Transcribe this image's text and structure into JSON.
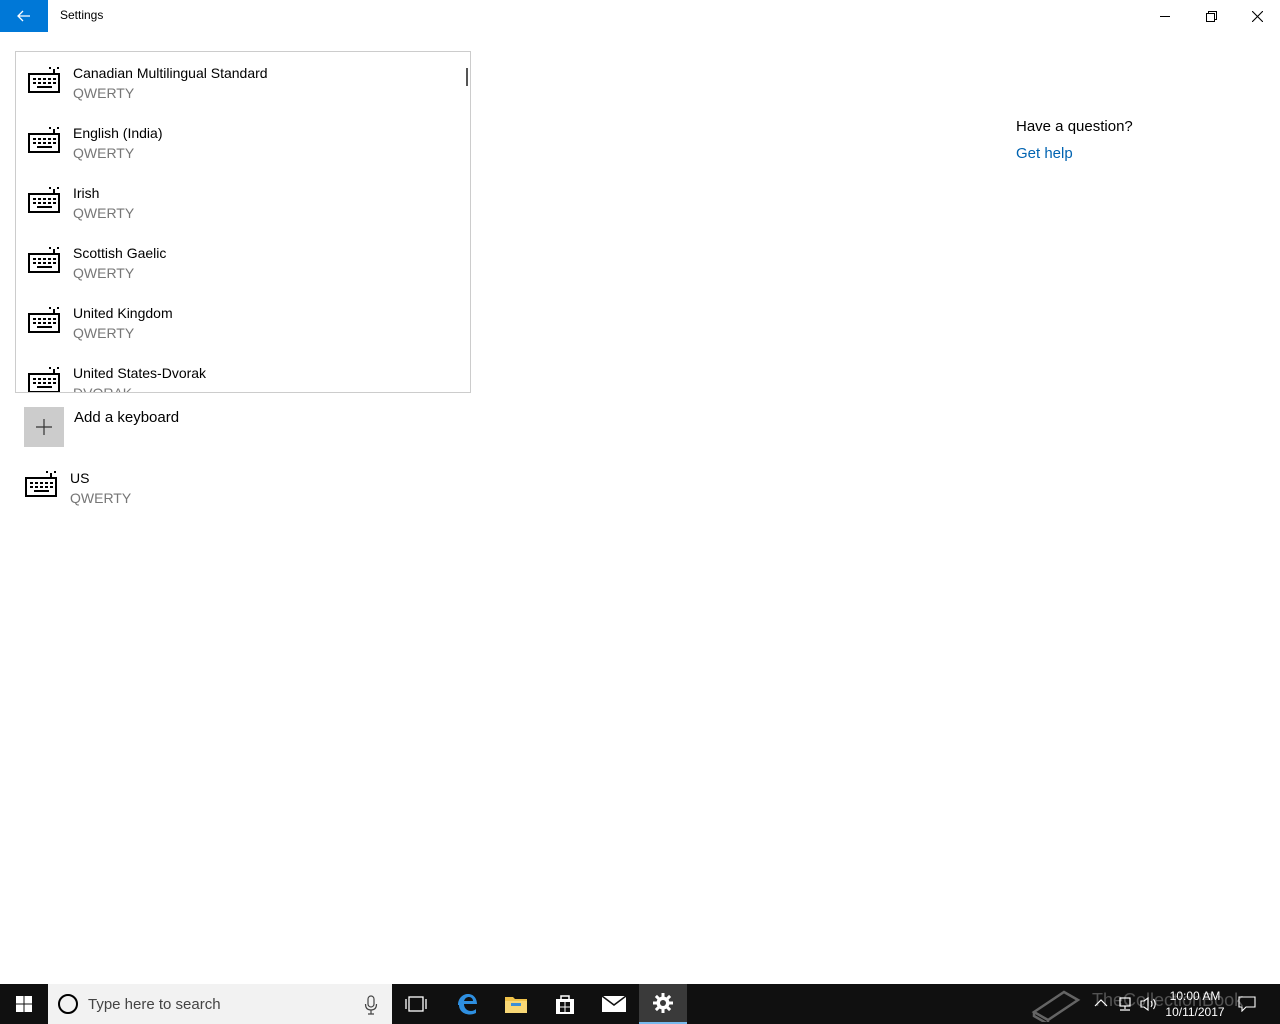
{
  "window": {
    "title": "Settings"
  },
  "keyboard_options": [
    {
      "name": "Canadian Multilingual Standard",
      "layout": "QWERTY"
    },
    {
      "name": "English (India)",
      "layout": "QWERTY"
    },
    {
      "name": "Irish",
      "layout": "QWERTY"
    },
    {
      "name": "Scottish Gaelic",
      "layout": "QWERTY"
    },
    {
      "name": "United Kingdom",
      "layout": "QWERTY"
    },
    {
      "name": "United States-Dvorak",
      "layout": "DVORAK"
    }
  ],
  "add_keyboard": {
    "label": "Add a keyboard"
  },
  "installed_keyboard": {
    "name": "US",
    "layout": "QWERTY"
  },
  "help": {
    "question": "Have a question?",
    "link": "Get help"
  },
  "taskbar": {
    "search_placeholder": "Type here to search",
    "time": "10:00 AM",
    "date": "10/11/2017",
    "watermark": "TheCollectionBook"
  },
  "colors": {
    "accent": "#0078d7",
    "link": "#0063b1",
    "secondary_text": "#767676",
    "taskbar": "#101010"
  }
}
